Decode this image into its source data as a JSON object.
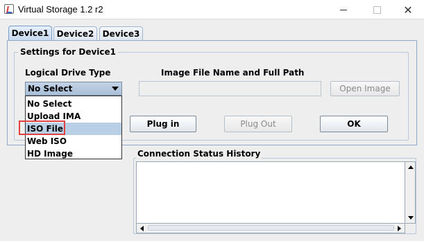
{
  "window": {
    "title": "Virtual Storage 1.2 r2",
    "min_icon": "minimize-icon",
    "max_icon": "maximize-icon",
    "close_symbol": "✕"
  },
  "tabs": [
    {
      "label": "Device1",
      "active": true
    },
    {
      "label": "Device2",
      "active": false
    },
    {
      "label": "Device3",
      "active": false
    }
  ],
  "settings": {
    "group_title": "Settings for Device1",
    "drive_type_label": "Logical Drive Type",
    "image_path_label": "Image File Name and Full Path",
    "drive_type_value": "No Select",
    "drive_type_options": [
      "No Select",
      "Upload IMA",
      "ISO File",
      "Web ISO",
      "HD Image"
    ],
    "highlighted_option": "ISO File",
    "image_path_value": "",
    "open_image_label": "Open Image",
    "plug_in_label": "Plug in",
    "plug_out_label": "Plug Out",
    "ok_label": "OK"
  },
  "status": {
    "title": "Connection Status History",
    "content": ""
  },
  "colors": {
    "highlight_border": "#e04040",
    "combo_bg": "#b8cfe5",
    "tab_border": "#7a9cc4"
  }
}
